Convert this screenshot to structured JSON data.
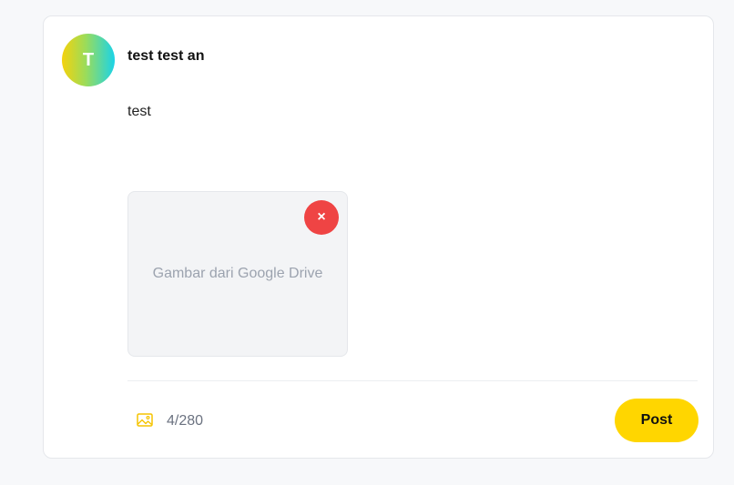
{
  "post": {
    "avatar_initial": "T",
    "username": "test test an",
    "text": "test"
  },
  "image_preview": {
    "caption": "Gambar dari Google Drive",
    "remove_label": "×"
  },
  "footer": {
    "char_count": "4/280",
    "post_label": "Post",
    "image_icon": "image-icon"
  },
  "colors": {
    "accent": "#ffd600",
    "remove": "#ef4444",
    "avatar_gradient": [
      "#f5d20c",
      "#1ad3e8"
    ]
  }
}
